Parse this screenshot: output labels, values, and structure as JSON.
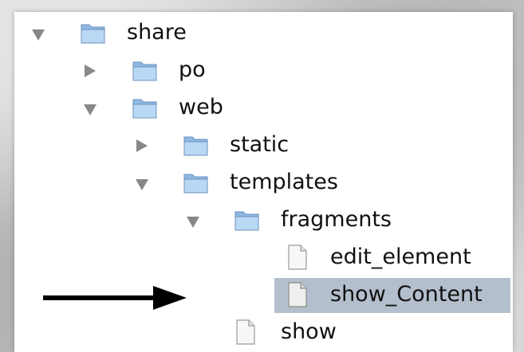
{
  "tree": {
    "nodes": [
      {
        "label": "share",
        "type": "folder",
        "state": "expanded"
      },
      {
        "label": "po",
        "type": "folder",
        "state": "collapsed"
      },
      {
        "label": "web",
        "type": "folder",
        "state": "expanded"
      },
      {
        "label": "static",
        "type": "folder",
        "state": "collapsed"
      },
      {
        "label": "templates",
        "type": "folder",
        "state": "expanded"
      },
      {
        "label": "fragments",
        "type": "folder",
        "state": "expanded"
      },
      {
        "label": "edit_element",
        "type": "file"
      },
      {
        "label": "show_Content",
        "type": "file",
        "selected": true
      },
      {
        "label": "show",
        "type": "file"
      }
    ]
  },
  "annotation": {
    "arrow_target": "show_Content",
    "arrow_color": "#000000"
  },
  "colors": {
    "selection": "#b4bfcd",
    "disclosure_triangle": "#888888",
    "folder": "#a9cdee",
    "file": "#f4f4f4"
  },
  "icons": {
    "folder": "folder-icon",
    "file": "document-icon",
    "expanded": "disclosure-triangle-down-icon",
    "collapsed": "disclosure-triangle-right-icon",
    "pointer": "arrow-right-icon"
  }
}
